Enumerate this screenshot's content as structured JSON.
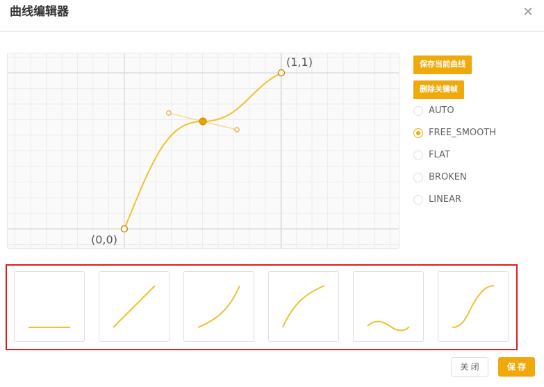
{
  "dialog": {
    "title": "曲线编辑器",
    "close_icon": "close-icon"
  },
  "editor": {
    "origin_label": "(0,0)",
    "end_label": "(1,1)",
    "curve_color": "#f0c030",
    "grid_color": "#e6e6e6"
  },
  "actions": {
    "save_curve_label": "保存当前曲线",
    "delete_keyframe_label": "删除关键帧"
  },
  "tangent_modes": {
    "selected": "FREE_SMOOTH",
    "options": [
      "AUTO",
      "FREE_SMOOTH",
      "FLAT",
      "BROKEN",
      "LINEAR"
    ]
  },
  "presets": [
    {
      "name": "constant"
    },
    {
      "name": "linear"
    },
    {
      "name": "ease-in"
    },
    {
      "name": "ease-out"
    },
    {
      "name": "wave"
    },
    {
      "name": "ease-in-out"
    }
  ],
  "footer": {
    "close_label": "关 闭",
    "save_label": "保 存"
  },
  "colors": {
    "accent": "#f0a90a",
    "highlight_border": "#e01b1b"
  }
}
